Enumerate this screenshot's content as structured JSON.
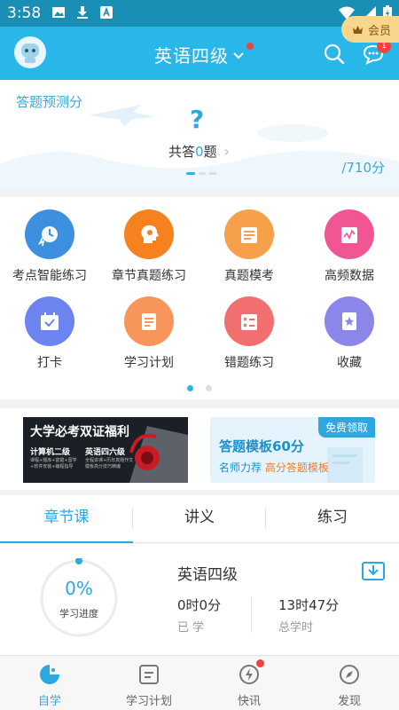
{
  "status_bar": {
    "time": "3:58"
  },
  "header": {
    "title": "英语四级",
    "message_badge": "1"
  },
  "predict": {
    "label": "答题预测分",
    "question_mark": "?",
    "count_prefix": "共答",
    "count_value": "0",
    "count_suffix": "题",
    "score": "/710分",
    "member_label": "会员"
  },
  "grid": [
    {
      "label": "考点智能练习",
      "icon": "clock-lightning-icon",
      "color": "#3d8fe0"
    },
    {
      "label": "章节真题练习",
      "icon": "head-gear-icon",
      "color": "#f5811f"
    },
    {
      "label": "真题模考",
      "icon": "folder-document-icon",
      "color": "#f7a04a"
    },
    {
      "label": "高频数据",
      "icon": "chart-card-icon",
      "color": "#f25594"
    },
    {
      "label": "打卡",
      "icon": "calendar-check-icon",
      "color": "#6b84f0"
    },
    {
      "label": "学习计划",
      "icon": "plan-document-icon",
      "color": "#f7955a"
    },
    {
      "label": "错题练习",
      "icon": "wrong-list-icon",
      "color": "#f26f6f"
    },
    {
      "label": "收藏",
      "icon": "star-book-icon",
      "color": "#8b86ea"
    }
  ],
  "banner_left": {
    "title": "大学必考双证福利",
    "item1": "计算机二级",
    "item2": "英语四六级",
    "text1": "课程+题库+富键+留学+软件安装+编程指导",
    "text2": "全程讲课+历年真题作文模板高分技巧精编"
  },
  "banner_right": {
    "tag": "免费领取",
    "title": "答题模板60分",
    "sub_prefix": "名师力荐",
    "sub_highlight": "高分答题模板"
  },
  "tabs": [
    "章节课",
    "讲义",
    "练习"
  ],
  "progress": {
    "percent": "0%",
    "percent_label": "学习进度",
    "course": "英语四级",
    "learned_value": "0时0分",
    "learned_label": "已 学",
    "total_value": "13时47分",
    "total_label": "总学时"
  },
  "bottom_nav": [
    {
      "label": "自学",
      "icon": "self-study-icon"
    },
    {
      "label": "学习计划",
      "icon": "study-plan-icon"
    },
    {
      "label": "快讯",
      "icon": "news-flash-icon"
    },
    {
      "label": "发现",
      "icon": "compass-icon"
    }
  ],
  "colors": {
    "primary": "#29b6e8",
    "accent": "#29a9e0",
    "badge": "#f5413c",
    "member": "#f8d68b"
  }
}
